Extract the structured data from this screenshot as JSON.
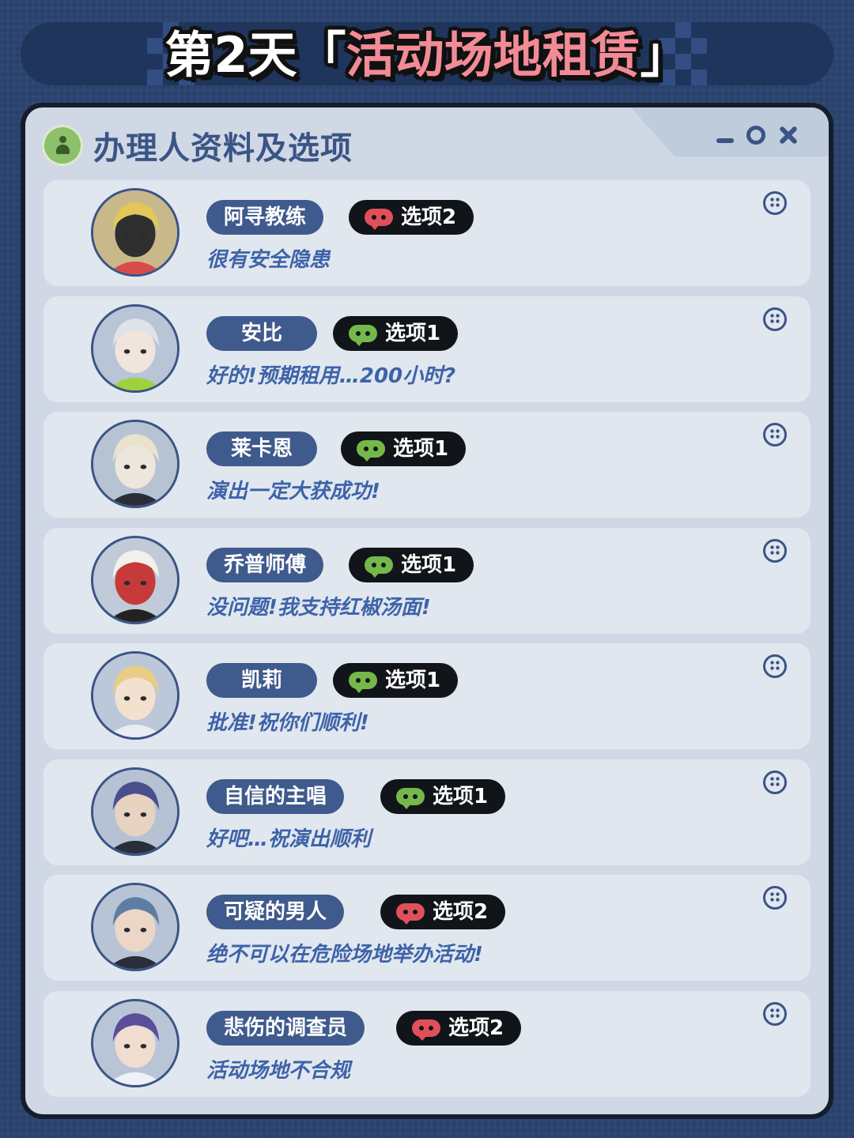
{
  "title": {
    "day": "第2天",
    "bracket_open": "「",
    "main": "活动场地租赁",
    "bracket_close": "」"
  },
  "panel": {
    "title": "办理人资料及选项",
    "icons": {
      "user": "user-icon",
      "minimize": "minimize-icon",
      "maximize": "maximize-icon",
      "close": "close-icon"
    }
  },
  "colors": {
    "background": "#2b4470",
    "panel": "#cfd8e4",
    "card": "#e1e7ef",
    "name_pill": "#3f5a8c",
    "quote_text": "#3d63a8",
    "title_accent": "#f28b96",
    "option_red": "#e0505a",
    "option_green": "#74b84a"
  },
  "entries": [
    {
      "name": "阿寻教练",
      "option": "选项2",
      "option_color": "red",
      "quote": "很有安全隐患"
    },
    {
      "name": "安比",
      "option": "选项1",
      "option_color": "green",
      "quote": "好的!预期租用…200小时?"
    },
    {
      "name": "莱卡恩",
      "option": "选项1",
      "option_color": "green",
      "quote": "演出一定大获成功!"
    },
    {
      "name": "乔普师傅",
      "option": "选项1",
      "option_color": "green",
      "quote": "没问题!我支持红椒汤面!"
    },
    {
      "name": "凯莉",
      "option": "选项1",
      "option_color": "green",
      "quote": "批准!祝你们顺利!"
    },
    {
      "name": "自信的主唱",
      "option": "选项1",
      "option_color": "green",
      "quote": "好吧…祝演出顺利"
    },
    {
      "name": "可疑的男人",
      "option": "选项2",
      "option_color": "red",
      "quote": "绝不可以在危险场地举办活动!"
    },
    {
      "name": "悲伤的调查员",
      "option": "选项2",
      "option_color": "red",
      "quote": "活动场地不合规"
    }
  ]
}
